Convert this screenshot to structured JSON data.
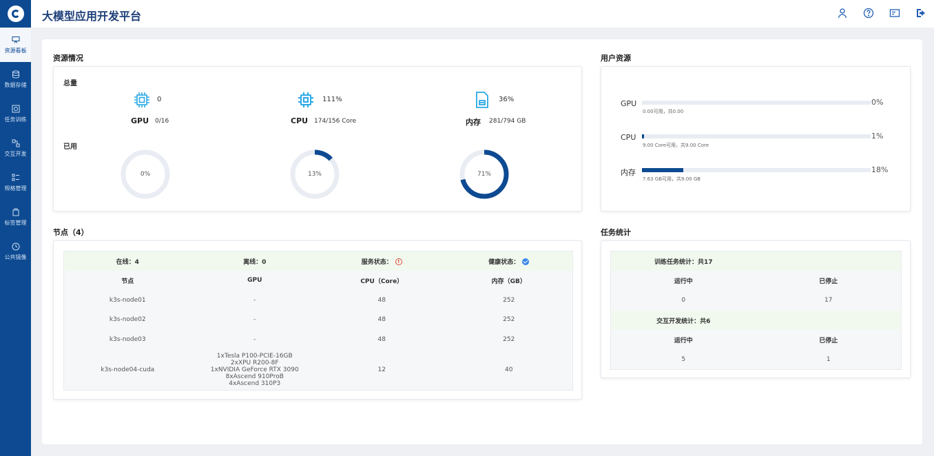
{
  "app": {
    "title": "大模型应用开发平台"
  },
  "sidebar": {
    "items": [
      {
        "label": "资源看板",
        "icon": "dashboard-icon",
        "active": true
      },
      {
        "label": "数据存储",
        "icon": "database-icon",
        "active": false
      },
      {
        "label": "任务训练",
        "icon": "training-icon",
        "active": false
      },
      {
        "label": "交互开发",
        "icon": "dev-icon",
        "active": false
      },
      {
        "label": "规格管理",
        "icon": "spec-icon",
        "active": false
      },
      {
        "label": "标签管理",
        "icon": "tag-icon",
        "active": false
      },
      {
        "label": "公共镜像",
        "icon": "image-icon",
        "active": false
      }
    ]
  },
  "header": {
    "icons": [
      "user-icon",
      "help-icon",
      "message-icon",
      "logout-icon"
    ]
  },
  "resources": {
    "title": "资源情况",
    "total_label": "总量",
    "used_label": "已用",
    "gpu": {
      "name": "GPU",
      "value": "0",
      "detail": "0/16",
      "used_pct": 0,
      "used_label": "0%"
    },
    "cpu": {
      "name": "CPU",
      "value": "111%",
      "detail": "174/156 Core",
      "used_pct": 13,
      "used_label": "13%"
    },
    "mem": {
      "name": "内存",
      "value": "36%",
      "detail": "281/794 GB",
      "used_pct": 71,
      "used_label": "71%"
    }
  },
  "user_resources": {
    "title": "用户资源",
    "rows": [
      {
        "label": "GPU",
        "pct": 0,
        "pct_label": "0%",
        "sub": "0.00可用，共0.00"
      },
      {
        "label": "CPU",
        "pct": 1,
        "pct_label": "1%",
        "sub": "9.00 Core可用，共9.00 Core"
      },
      {
        "label": "内存",
        "pct": 18,
        "pct_label": "18%",
        "sub": "7.63 GB可用，共9.00 GB"
      }
    ]
  },
  "nodes": {
    "title": "节点（4）",
    "summary": {
      "online": "在线：4",
      "offline": "离线：0",
      "service": "服务状态：",
      "health": "健康状态："
    },
    "headers": [
      "节点",
      "GPU",
      "CPU（Core）",
      "内存（GB）"
    ],
    "rows": [
      {
        "node": "k3s-node01",
        "gpu": [
          "-"
        ],
        "cpu": "48",
        "mem": "252"
      },
      {
        "node": "k3s-node02",
        "gpu": [
          "-"
        ],
        "cpu": "48",
        "mem": "252"
      },
      {
        "node": "k3s-node03",
        "gpu": [
          "-"
        ],
        "cpu": "48",
        "mem": "252"
      },
      {
        "node": "k3s-node04-cuda",
        "gpu": [
          "1xTesla P100-PCIE-16GB",
          "2xXPU R200-8F",
          "1xNVIDIA GeForce RTX 3090",
          "8xAscend 910ProB",
          "4xAscend 310P3"
        ],
        "cpu": "12",
        "mem": "40"
      }
    ]
  },
  "tasks": {
    "title": "任务统计",
    "training": {
      "title": "训练任务统计：共17",
      "running_label": "运行中",
      "stopped_label": "已停止",
      "running": "0",
      "stopped": "17"
    },
    "interactive": {
      "title": "交互开发统计：共6",
      "running_label": "运行中",
      "stopped_label": "已停止",
      "running": "5",
      "stopped": "1"
    }
  }
}
